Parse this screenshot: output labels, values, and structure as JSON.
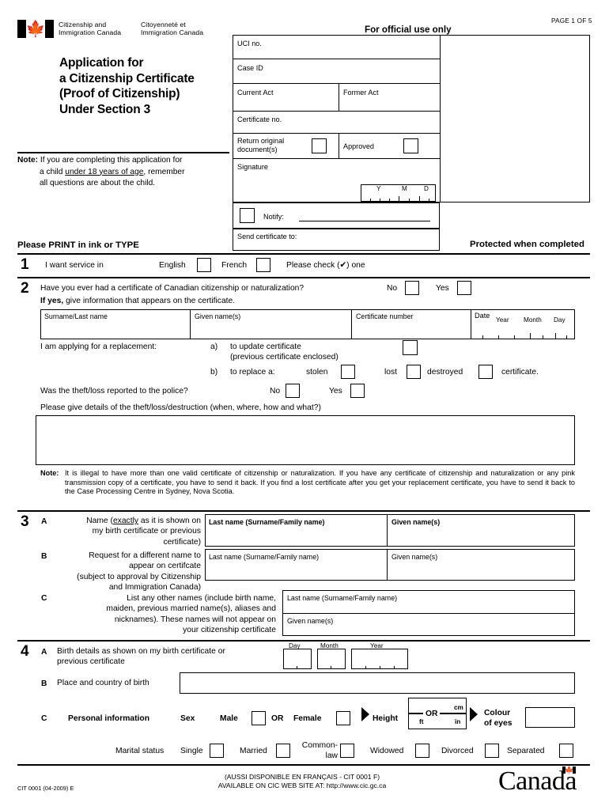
{
  "header": {
    "flag_icon": "canada-flag-icon",
    "dept_en": "Citizenship and\nImmigration Canada",
    "dept_en_l1": "Citizenship and",
    "dept_en_l2": "Immigration Canada",
    "dept_fr_l1": "Citoyenneté et",
    "dept_fr_l2": "Immigration Canada",
    "title_l1": "Application for",
    "title_l2": "a Citizenship Certificate",
    "title_l3": "(Proof of Citizenship)",
    "title_l4": "Under Section 3",
    "note_label": "Note:",
    "note_l1a": "If you are completing this application for",
    "note_l2a": "a child ",
    "note_l2u": "under 18 years of age",
    "note_l2b": ", remember",
    "note_l3": "all questions are about the child.",
    "print_in_ink": "Please PRINT in ink or TYPE",
    "official_use": "For official use only",
    "page_of": "PAGE 1 OF 5",
    "protected": "Protected when completed"
  },
  "official_box": {
    "uci_no": "UCI no.",
    "case_id": "Case ID",
    "current_act": "Current Act",
    "former_act": "Former Act",
    "certificate_no": "Certificate no.",
    "return_original_l1": "Return original",
    "return_original_l2": "document(s)",
    "approved": "Approved",
    "signature": "Signature",
    "date_y": "Y",
    "date_m": "M",
    "date_d": "D",
    "notify": "Notify:",
    "send_certificate_to": "Send certificate to:"
  },
  "section1": {
    "number": "1",
    "prompt": "I want service in",
    "english": "English",
    "french": "French",
    "check_one": "Please check (✔) one"
  },
  "section2": {
    "number": "2",
    "question": "Have you ever had a certificate of Canadian citizenship or naturalization?",
    "no": "No",
    "yes": "Yes",
    "ifyes_bold": "If yes,",
    "ifyes_rest": " give information that appears on the certificate.",
    "table": {
      "surname": "Surname/Last name",
      "given": "Given name(s)",
      "cert_number": "Certificate number",
      "date": "Date",
      "year": "Year",
      "month": "Month",
      "day": "Day"
    },
    "replacement_label": "I am applying for a replacement:",
    "opt_a_marker": "a)",
    "opt_a_l1": "to update certificate",
    "opt_a_l2": "(previous certificate enclosed)",
    "opt_b_marker": "b)",
    "opt_b_label": "to replace a:",
    "stolen": "stolen",
    "lost": "lost",
    "destroyed": "destroyed",
    "certificate_word": "certificate.",
    "police_question": "Was the theft/loss reported to the police?",
    "police_no": "No",
    "police_yes": "Yes",
    "details_prompt": "Please give details of the theft/loss/destruction (when, where, how and what?)",
    "details_value": "",
    "note_label": "Note:",
    "note_text": "It is illegal to have more than one valid certificate of citizenship or naturalization. If you have any certificate of citizenship and naturalization or any pink transmission copy of a certificate, you have to send it back. If you find a lost certificate after you get your replacement certificate, you have to send it back to the Case Processing Centre in Sydney, Nova Scotia."
  },
  "section3": {
    "number": "3",
    "a_letter": "A",
    "a_l1a": "Name (",
    "a_l1u": "exactly",
    "a_l1b": " as it is shown on",
    "a_l2": "my birth certificate or previous",
    "a_l3": "certificate)",
    "a_lastname": "Last name (Surname/Family name)",
    "a_given": "Given name(s)",
    "b_letter": "B",
    "b_l1": "Request for a different name to",
    "b_l2": "appear on certifcate",
    "b_l3": "(subject to approval by Citizenship",
    "b_l4": "and Immigration Canada)",
    "b_lastname": "Last name (Surname/Family name)",
    "b_given": "Given name(s)",
    "c_letter": "C",
    "c_l1": "List any other names (include birth name,",
    "c_l2": "maiden, previous married name(s), aliases and",
    "c_l3": "nicknames). These names will not appear on",
    "c_l4": "your citizenship certificate",
    "c_lastname": "Last name (Surname/Family name)",
    "c_given": "Given name(s)"
  },
  "section4": {
    "number": "4",
    "a_letter": "A",
    "a_l1": "Birth details as shown on my birth certificate or",
    "a_l2": "previous certificate",
    "day": "Day",
    "month": "Month",
    "year": "Year",
    "b_letter": "B",
    "b_label": "Place and country of birth",
    "b_value": "",
    "c_letter": "C",
    "c_label": "Personal information",
    "sex": "Sex",
    "male": "Male",
    "or": "OR",
    "female": "Female",
    "height": "Height",
    "height_or": "OR",
    "height_cm": "cm",
    "height_ft": "ft",
    "height_in": "in",
    "colour_l1": "Colour",
    "colour_l2": "of eyes",
    "colour_value": "",
    "marital_status": "Marital status",
    "single": "Single",
    "married": "Married",
    "common_l1": "Common-",
    "common_l2": "law",
    "widowed": "Widowed",
    "divorced": "Divorced",
    "separated": "Separated"
  },
  "footer": {
    "form_code": "CIT 0001 (04-2009) E",
    "french_line": "(AUSSI DISPONIBLE EN FRANÇAIS - CIT 0001 F)",
    "web_line": "AVAILABLE ON CIC WEB SITE AT: http://www.cic.gc.ca",
    "wordmark": "Canada"
  }
}
